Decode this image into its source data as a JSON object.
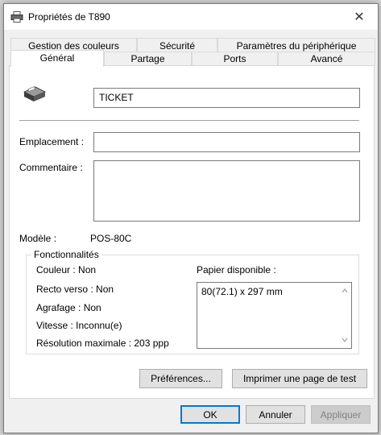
{
  "window": {
    "title": "Propriétés de T890",
    "close_glyph": "✕"
  },
  "tabs": {
    "row1": [
      "Gestion des couleurs",
      "Sécurité",
      "Paramètres du périphérique"
    ],
    "row2": [
      "Général",
      "Partage",
      "Ports",
      "Avancé"
    ],
    "active": "Général"
  },
  "general": {
    "printer_name": "TICKET",
    "location_label": "Emplacement :",
    "location_value": "",
    "comment_label": "Commentaire :",
    "comment_value": "",
    "model_label": "Modèle :",
    "model_value": "POS-80C"
  },
  "features": {
    "title": "Fonctionnalités",
    "color": "Couleur : Non",
    "duplex": "Recto verso : Non",
    "staple": "Agrafage : Non",
    "speed": "Vitesse : Inconnu(e)",
    "resolution": "Résolution maximale : 203 ppp",
    "paper_label": "Papier disponible :",
    "paper_items": [
      "80(72.1) x 297 mm"
    ]
  },
  "buttons": {
    "preferences": "Préférences...",
    "test_page": "Imprimer une page de test",
    "ok": "OK",
    "cancel": "Annuler",
    "apply": "Appliquer"
  },
  "icons": {
    "title": "printer-icon",
    "printer": "printer-icon",
    "close": "close-icon",
    "scroll_up": "chevron-up-icon",
    "scroll_down": "chevron-down-icon"
  },
  "colors": {
    "accent": "#0078d7",
    "dialog_bg": "#f0f0f0",
    "panel_bg": "#ffffff"
  }
}
